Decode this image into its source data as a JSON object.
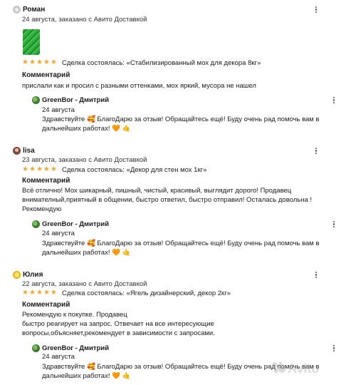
{
  "reviews": [
    {
      "author": "Роман",
      "meta": "24 августа, заказано с Авито Доставкой",
      "rating": 5,
      "deal": "Сделка состоялась: «Стабилизированный мох для декора 8кг»",
      "comment_label": "Комментарий",
      "comment": "прислали как и просил с разными оттенками, мох яркий, мусора не нашел",
      "reply": {
        "author": "GreenBor - Дмитрий",
        "date": "24 августа",
        "text": "Здравствуйте 🥰 БлагоДарю за отзыв! Обращайтесь ещё! Буду очень рад помочь вам в\nдальнейших работах! 🧡 🤙"
      }
    },
    {
      "author": "lisa",
      "meta": "23 августа, заказано с Авито Доставкой",
      "rating": 5,
      "deal": "Сделка состоялась: «Декор для стен мох 1кг»",
      "comment_label": "Комментарий",
      "comment": "Всё отлично! Мох шикарный, пишный, чистый, красивый, выглядит дорого! Продавец\nвнимателный,приятный в общении, быстро ответил, быстро отправил! Осталась довольна !\nРекомендую",
      "reply": {
        "author": "GreenBor - Дмитрий",
        "date": "24 августа",
        "text": "Здравствуйте 🥰 БлагоДарю за отзыв! Обращайтесь ещё! Буду очень рад помочь вам в\nдальнейших работах! 🧡 🤙"
      }
    },
    {
      "author": "Юлия",
      "meta": "22 августа, заказано с Авито Доставкой",
      "rating": 5,
      "deal": "Сделка состоялась: «Ягель дизайнерский, декор 2кг»",
      "comment_label": "Комментарий",
      "comment": "Рекомендую к покупке. Продавец\nбыстро реагирует на запрос. Отвечает на все интересующие\nвопросы,объясняет,рекомендует в зависимости с запросами.",
      "reply": {
        "author": "GreenBor - Дмитрий",
        "date": "24 августа",
        "text": "Здравствуйте 🥰 БлагоДарю за отзыв! Обращайтесь ещё! Буду очень рад помочь вам в\nдальнейших работах! 🧡 🤙"
      }
    }
  ],
  "watermark": "Avito",
  "colors": {
    "star": "#f2a72a",
    "accent": "#2fae3c"
  }
}
